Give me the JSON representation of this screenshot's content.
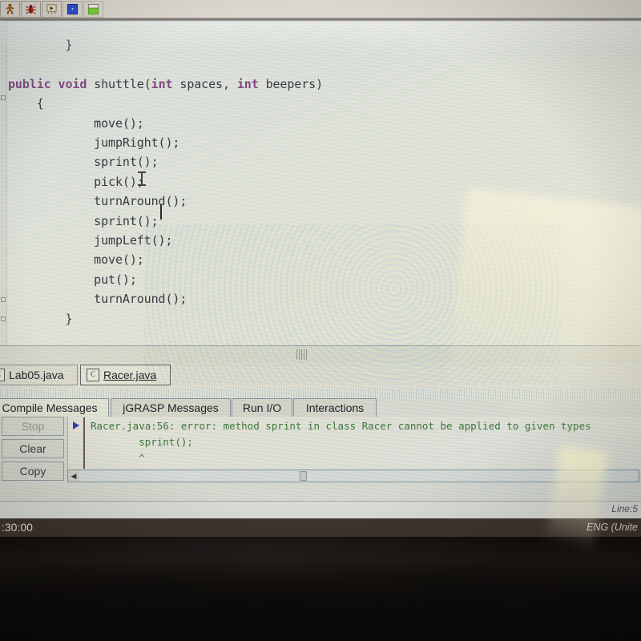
{
  "toolbar": {
    "buttons": [
      {
        "name": "run-applet-icon",
        "label": "Run"
      },
      {
        "name": "debug-bug-icon",
        "label": "Debug"
      },
      {
        "name": "run-in-canvas-icon",
        "label": "Run in Canvas"
      },
      {
        "name": "blue-square-icon",
        "label": "Blue"
      },
      {
        "name": "green-square-icon",
        "label": "Green"
      }
    ]
  },
  "editor": {
    "lines": [
      {
        "indent": 2,
        "parts": [
          {
            "t": "}",
            "k": "id"
          }
        ]
      },
      {
        "indent": 0,
        "parts": []
      },
      {
        "indent": 0,
        "parts": [
          {
            "t": "public",
            "k": "kw"
          },
          {
            "t": " ",
            "k": "id"
          },
          {
            "t": "void",
            "k": "kw"
          },
          {
            "t": " shuttle(",
            "k": "id"
          },
          {
            "t": "int",
            "k": "kw"
          },
          {
            "t": " spaces, ",
            "k": "id"
          },
          {
            "t": "int",
            "k": "kw"
          },
          {
            "t": " beepers)",
            "k": "id"
          }
        ]
      },
      {
        "indent": 1,
        "parts": [
          {
            "t": "{",
            "k": "id"
          }
        ]
      },
      {
        "indent": 3,
        "parts": [
          {
            "t": "move();",
            "k": "id"
          }
        ]
      },
      {
        "indent": 3,
        "parts": [
          {
            "t": "jumpRight();",
            "k": "id"
          }
        ]
      },
      {
        "indent": 3,
        "parts": [
          {
            "t": "sprint();",
            "k": "id"
          }
        ]
      },
      {
        "indent": 3,
        "parts": [
          {
            "t": "pick();",
            "k": "id"
          }
        ]
      },
      {
        "indent": 3,
        "parts": [
          {
            "t": "turnAround();",
            "k": "id"
          }
        ]
      },
      {
        "indent": 3,
        "parts": [
          {
            "t": "sprint();",
            "k": "id"
          }
        ]
      },
      {
        "indent": 3,
        "parts": [
          {
            "t": "jumpLeft();",
            "k": "id"
          }
        ]
      },
      {
        "indent": 3,
        "parts": [
          {
            "t": "move();",
            "k": "id"
          }
        ]
      },
      {
        "indent": 3,
        "parts": [
          {
            "t": "put();",
            "k": "id"
          }
        ]
      },
      {
        "indent": 3,
        "parts": [
          {
            "t": "turnAround();",
            "k": "id"
          }
        ]
      },
      {
        "indent": 2,
        "parts": [
          {
            "t": "}",
            "k": "id"
          }
        ]
      }
    ]
  },
  "file_tabs": [
    {
      "label": "Lab05.java",
      "icon": "java-class-icon",
      "active": false
    },
    {
      "label": "Racer.java",
      "icon": "java-class-icon",
      "active": true
    }
  ],
  "message_tabs": [
    {
      "label": "Compile Messages",
      "active": true
    },
    {
      "label": "jGRASP Messages",
      "active": false
    },
    {
      "label": "Run I/O",
      "active": false
    },
    {
      "label": "Interactions",
      "active": false
    }
  ],
  "message_buttons": [
    {
      "label": "Stop",
      "enabled": false
    },
    {
      "label": "Clear",
      "enabled": true
    },
    {
      "label": "Copy",
      "enabled": true
    }
  ],
  "compile_output": {
    "line1": "Racer.java:56: error: method sprint in class Racer cannot be applied to given types",
    "line2": "        sprint();",
    "line3": "        ^",
    "color": "#3d7a3d"
  },
  "status_bar": {
    "line_indicator": "Line:5"
  },
  "taskbar": {
    "clock": ":30:00",
    "language": "ENG (Unite"
  }
}
